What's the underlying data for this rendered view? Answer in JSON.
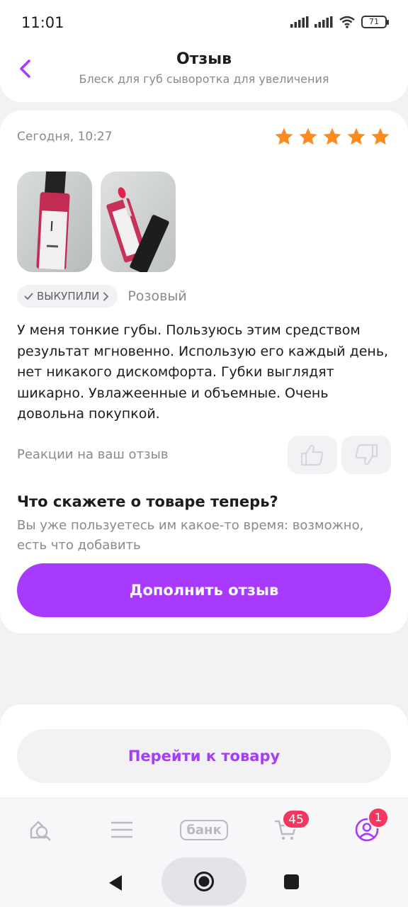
{
  "status_bar": {
    "time": "11:01",
    "battery": "71"
  },
  "header": {
    "title": "Отзыв",
    "subtitle": "Блеск для губ сыворотка для увеличения"
  },
  "review": {
    "date": "Сегодня, 10:27",
    "rating": 5,
    "rating_max": 5,
    "star_color": "#ff8a1f",
    "badge": "ВЫКУПИЛИ",
    "variant": "Розовый",
    "text": "У меня тонкие губы. Пользуюсь этим средством результат мгновенно. Использую его каждый день, нет никакого дискомфорта. Губки выглядят шикарно. Увлажеенные и объемные. Очень довольна покупкой.",
    "reactions_label": "Реакции на ваш отзыв"
  },
  "prompt": {
    "title": "Что скажете о товаре теперь?",
    "text": "Вы уже пользуетесь им какое-то время: возможно, есть что добавить",
    "button": "Дополнить отзыв"
  },
  "go_to_product": "Перейти к товару",
  "tab_bar": {
    "bank_label": "банк",
    "cart_count": "45",
    "profile_count": "1"
  },
  "colors": {
    "accent": "#a73afd",
    "badge_red": "#f5365e",
    "star": "#ff8a1f"
  },
  "icons": [
    "back-chevron-icon",
    "star-icon",
    "checkmark-icon",
    "chevron-right-icon",
    "thumbs-up-icon",
    "thumbs-down-icon",
    "home-search-icon",
    "menu-icon",
    "cart-icon",
    "profile-icon",
    "nav-back-icon",
    "nav-home-icon",
    "nav-recents-icon"
  ]
}
